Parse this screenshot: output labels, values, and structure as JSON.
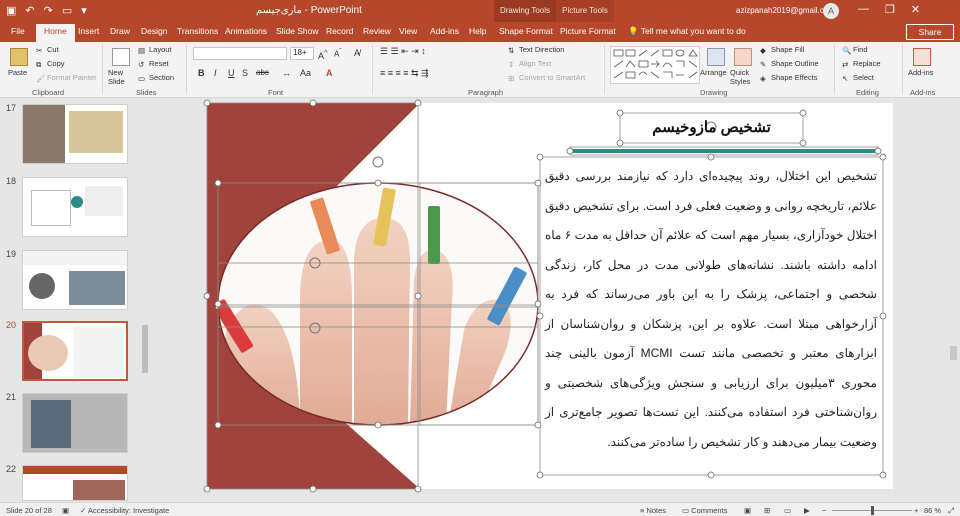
{
  "window": {
    "app_title": "PowerPoint",
    "file_title": "ماری‌جیسم",
    "user_email": "azizpanah2019@gmail.com",
    "avatar_letter": "A",
    "context_groups": [
      "Drawing Tools",
      "Picture Tools"
    ],
    "controls": [
      "—",
      "❐",
      "✕"
    ]
  },
  "tabs": [
    {
      "label": "File"
    },
    {
      "label": "Home"
    },
    {
      "label": "Insert"
    },
    {
      "label": "Draw"
    },
    {
      "label": "Design"
    },
    {
      "label": "Transitions"
    },
    {
      "label": "Animations"
    },
    {
      "label": "Slide Show"
    },
    {
      "label": "Record"
    },
    {
      "label": "Review"
    },
    {
      "label": "View"
    },
    {
      "label": "Add-ins"
    },
    {
      "label": "Help"
    },
    {
      "label": "Shape Format"
    },
    {
      "label": "Picture Format"
    }
  ],
  "active_tab": "Home",
  "tell_me": "Tell me what you want to do",
  "share": "Share",
  "ribbon": {
    "clipboard": {
      "paste": "Paste",
      "cut": "Cut",
      "copy": "Copy",
      "format_painter": "Format Painter",
      "label": "Clipboard"
    },
    "slides": {
      "new_slide": "New Slide",
      "layout": "Layout",
      "reset": "Reset",
      "section": "Section",
      "label": "Slides"
    },
    "font": {
      "font_name": "",
      "font_size": "18+",
      "label": "Font",
      "bold": "B",
      "italic": "I",
      "underline": "U",
      "shadow": "S",
      "strike": "abc"
    },
    "paragraph": {
      "text_direction": "Text Direction",
      "align_text": "Align Text",
      "convert_smartart": "Convert to SmartArt",
      "label": "Paragraph"
    },
    "drawing": {
      "arrange": "Arrange",
      "quick_styles": "Quick Styles",
      "shape_fill": "Shape Fill",
      "shape_outline": "Shape Outline",
      "shape_effects": "Shape Effects",
      "label": "Drawing"
    },
    "editing": {
      "find": "Find",
      "replace": "Replace",
      "select": "Select",
      "label": "Editing"
    },
    "addins": {
      "addins": "Add-ins",
      "label": "Add-ins"
    }
  },
  "thumbnails": [
    {
      "number": "17"
    },
    {
      "number": "18"
    },
    {
      "number": "19"
    },
    {
      "number": "20",
      "selected": true
    },
    {
      "number": "21"
    },
    {
      "number": "22"
    }
  ],
  "slide": {
    "heading": "تشخیص مازوخیسم",
    "body": "تشخیص این اختلال، روند پیچیده‌ای دارد که نیازمند بررسی دقیق علائم، تاریخچه روانی و وضعیت فعلی فرد است. برای تشخیص دقیق اختلال خودآزاری، بسیار مهم است که علائم آن حداقل به مدت ۶ ماه ادامه داشته باشند. نشانه‌های طولانی مدت در محل کار، زندگی شخصی و اجتماعی، پزشک را به این باور می‌رساند که فرد به آزارخواهی مبتلا است. علاوه بر این، پزشکان و روان‌شناسان از ابزارهای معتبر و تخصصی مانند تست MCMI آزمون بالینی چند محوری ۳میلیون برای ارزیابی و سنجش ویژگی‌های شخصیتی و روان‌شناختی فرد استفاده می‌کنند. این تست‌ها تصویر جامع‌تری از وضعیت بیمار می‌دهند و کار تشخیص را ساده‌تر می‌کنند.",
    "accent_color": "#a0433a",
    "teal_color": "#2d8a86"
  },
  "status": {
    "slide_of": "Slide 20 of 28",
    "accessibility": "Accessibility: Investigate",
    "notes": "Notes",
    "comments": "Comments",
    "zoom": "86 %"
  }
}
